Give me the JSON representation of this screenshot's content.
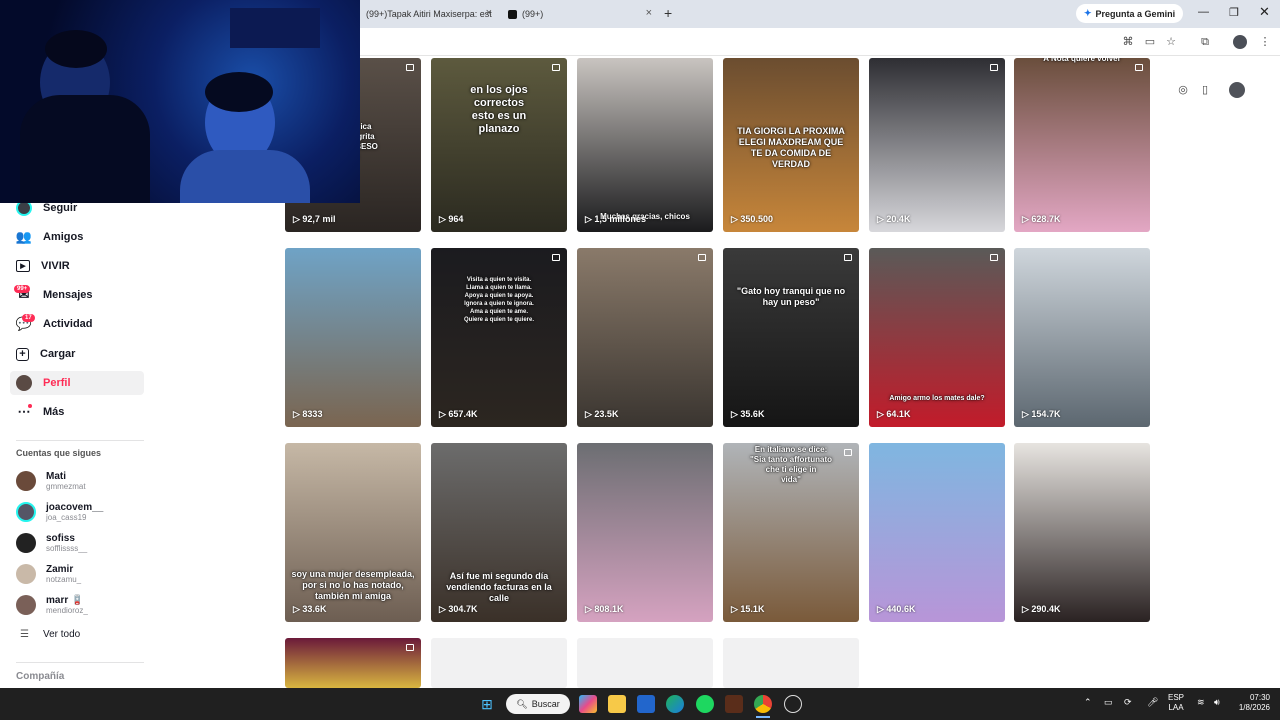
{
  "browser": {
    "tabs": [
      {
        "label": "(99+)Tapak Aitiri Maxiserpa: est"
      },
      {
        "label": "(99+)"
      }
    ],
    "gemini_label": "Pregunta a Gemini",
    "new_tab": "+",
    "close_symbol": "×"
  },
  "sidebar": {
    "items": [
      {
        "label": "Seguir",
        "icon": "avatar-icon"
      },
      {
        "label": "Amigos",
        "icon": "friends-icon"
      },
      {
        "label": "VIVIR",
        "icon": "live-icon"
      },
      {
        "label": "Mensajes",
        "icon": "messages-icon",
        "badge": "99+"
      },
      {
        "label": "Actividad",
        "icon": "activity-icon",
        "badge": "17"
      },
      {
        "label": "Cargar",
        "icon": "upload-icon"
      },
      {
        "label": "Perfil",
        "icon": "profile-icon"
      },
      {
        "label": "Más",
        "icon": "more-icon"
      }
    ],
    "following_title": "Cuentas que sigues",
    "accounts": [
      {
        "name": "Mati",
        "handle": "gmmezmat"
      },
      {
        "name": "joacovem__",
        "handle": "joa_cass19"
      },
      {
        "name": "sofiss",
        "handle": "sofflissss__"
      },
      {
        "name": "Zamir",
        "handle": "notzamu_"
      },
      {
        "name": "marr 🪫",
        "handle": "mendioroz_"
      }
    ],
    "see_all": "Ver todo",
    "company": "Compañía"
  },
  "grid": {
    "videos": [
      {
        "views": "92,7 mil",
        "caption": "una chica\namigo grita\nRE UN BESO\nOS"
      },
      {
        "views": "964",
        "caption": "en los ojos\ncorrectos\nesto es un\nplanazo"
      },
      {
        "views": "1,5 millones",
        "caption": "Muchas gracias, chicos"
      },
      {
        "views": "350.500",
        "caption": "TIA GIORGI LA PROXIMA\nELEGI MAXDREAM QUE\nTE DA COMIDA DE\nVERDAD"
      },
      {
        "views": "20.4K",
        "caption": ""
      },
      {
        "views": "628.7K",
        "caption": "A Nota quiere volver"
      },
      {
        "views": "8333",
        "caption": ""
      },
      {
        "views": "657.4K",
        "caption": "Visita a quien te visita.\nLlama a quien te llama.\nApoya a quien te apoya.\nIgnora a quien te ignora.\nAma a quien te ame.\nQuiere a quien te quiere."
      },
      {
        "views": "23.5K",
        "caption": ""
      },
      {
        "views": "35.6K",
        "caption": "\"Gato hoy tranqui que no\nhay un peso\""
      },
      {
        "views": "64.1K",
        "caption": "Amigo armo los mates dale?"
      },
      {
        "views": "154.7K",
        "caption": ""
      },
      {
        "views": "33.6K",
        "caption": "soy una mujer desempleada,\npor si no lo has notado,\ntambién mi amiga"
      },
      {
        "views": "304.7K",
        "caption": "Así fue mi segundo día\nvendiendo facturas en la\ncalle"
      },
      {
        "views": "808.1K",
        "caption": ""
      },
      {
        "views": "15.1K",
        "caption": "En italiano se dice:\n\"Sia tanto affortunato\nche ti elige in\nvida\""
      },
      {
        "views": "440.6K",
        "caption": ""
      },
      {
        "views": "290.4K",
        "caption": ""
      }
    ]
  },
  "taskbar": {
    "search_label": "Buscar",
    "lang_line1": "ESP",
    "lang_line2": "LAA",
    "time": "07:30",
    "date": "1/8/2026"
  },
  "colors": {
    "accent": "#fe2c55",
    "taskbar": "#202020",
    "tabbar": "#dee3eb"
  }
}
